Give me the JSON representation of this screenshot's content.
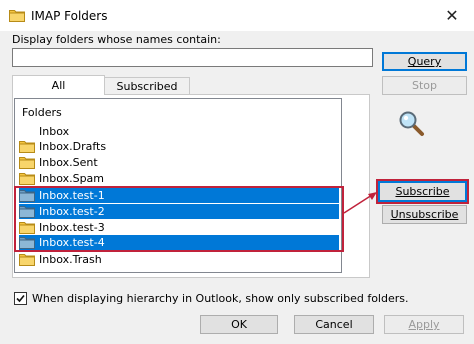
{
  "window": {
    "title": "IMAP Folders",
    "close_glyph": "✕"
  },
  "filter": {
    "label": "Display folders whose names contain:",
    "value": ""
  },
  "tabs": [
    {
      "label": "All",
      "active": true
    },
    {
      "label": "Subscribed",
      "active": false
    }
  ],
  "tree": {
    "header": "Folders",
    "items": [
      {
        "label": "Inbox",
        "icon": "none",
        "selected": false
      },
      {
        "label": "Inbox.Drafts",
        "icon": "folder-icon",
        "selected": false
      },
      {
        "label": "Inbox.Sent",
        "icon": "folder-icon",
        "selected": false
      },
      {
        "label": "Inbox.Spam",
        "icon": "folder-icon",
        "selected": false
      },
      {
        "label": "Inbox.test-1",
        "icon": "folder-icon",
        "selected": true
      },
      {
        "label": "Inbox.test-2",
        "icon": "folder-icon",
        "selected": true
      },
      {
        "label": "Inbox.test-3",
        "icon": "folder-icon",
        "selected": false
      },
      {
        "label": "Inbox.test-4",
        "icon": "folder-icon",
        "selected": true
      },
      {
        "label": "Inbox.Trash",
        "icon": "folder-icon",
        "selected": false
      }
    ]
  },
  "buttons": {
    "query": "Query",
    "stop": "Stop",
    "subscribe": "Subscribe",
    "unsubscribe": "Unsubscribe",
    "ok": "OK",
    "cancel": "Cancel",
    "apply": "Apply"
  },
  "checkbox": {
    "label": "When displaying hierarchy in Outlook, show only subscribed folders.",
    "checked": true
  },
  "colors": {
    "selection": "#0078d7",
    "highlight_outline": "#c0223b",
    "folder": "#f5c542"
  }
}
